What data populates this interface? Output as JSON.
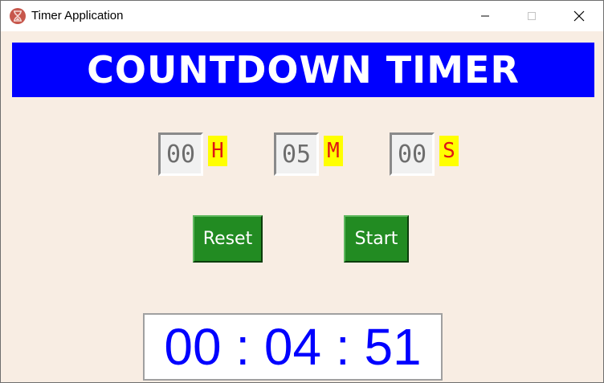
{
  "window": {
    "title": "Timer Application",
    "icon": "hourglass-icon"
  },
  "header": {
    "title": "COUNTDOWN TIMER"
  },
  "inputs": {
    "hours": {
      "value": "00",
      "unit": "H"
    },
    "minutes": {
      "value": "05",
      "unit": "M"
    },
    "seconds": {
      "value": "00",
      "unit": "S"
    }
  },
  "buttons": {
    "reset_label": "Reset",
    "start_label": "Start"
  },
  "display": {
    "countdown": "00 : 04 : 51"
  },
  "colors": {
    "background": "#f8ede3",
    "banner": "#0000ff",
    "button": "#228b22",
    "unit_label_bg": "#ffff00",
    "unit_label_text": "#e01515",
    "display_text": "#0000ff"
  }
}
